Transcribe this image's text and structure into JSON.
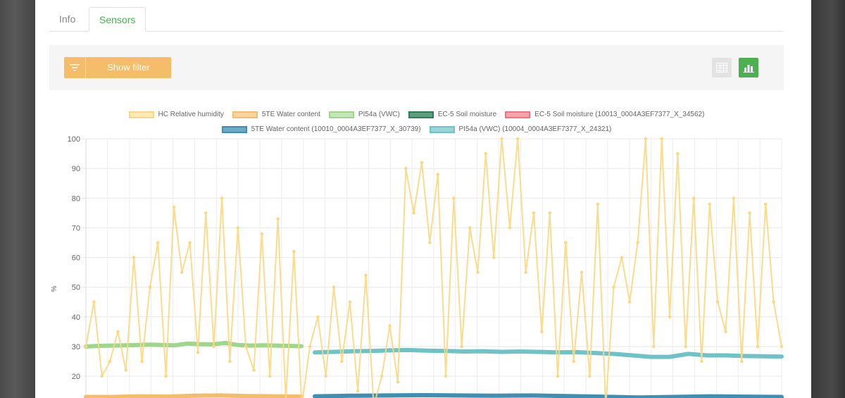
{
  "tabs": [
    {
      "label": "Info",
      "active": false
    },
    {
      "label": "Sensors",
      "active": true
    }
  ],
  "toolbar": {
    "filter_label": "Show filter",
    "filter_icon": "filter-icon",
    "table_view_icon": "table-icon",
    "chart_view_icon": "bar-chart-icon",
    "accent_color": "#f5bc6a",
    "active_view_color": "#4caf50"
  },
  "chart_data": {
    "type": "line",
    "ylabel": "%",
    "ylim": [
      20,
      100
    ],
    "yticks": [
      100,
      90,
      80,
      70,
      60,
      50,
      40,
      30,
      20
    ],
    "grid": true,
    "legend_position": "top-center",
    "legend": [
      {
        "name": "HC Relative humidity",
        "color": "#fbd880"
      },
      {
        "name": "5TE Water content",
        "color": "#f5bc6a"
      },
      {
        "name": "PI54a (VWC)",
        "color": "#9ed68c"
      },
      {
        "name": "EC-5 Soil moisture",
        "color": "#2e7d59"
      },
      {
        "name": "EC-5 Soil moisture (10013_0004A3EF7377_X_34562)",
        "color": "#f4727e"
      },
      {
        "name": "5TE Water content (10010_0004A3EF7377_X_30739)",
        "color": "#3e8fb3"
      },
      {
        "name": "PI54a (VWC) (10004_0004A3EF7377_X_24321)",
        "color": "#6fc2c6"
      }
    ],
    "series": [
      {
        "name": "HC Relative humidity",
        "color": "#fbd880",
        "values": [
          30,
          45,
          20,
          25,
          35,
          22,
          60,
          25,
          50,
          65,
          20,
          77,
          55,
          65,
          28,
          75,
          30,
          80,
          25,
          70,
          30,
          22,
          68,
          20,
          73,
          12,
          62,
          10,
          30,
          40,
          20,
          50,
          25,
          45,
          15,
          54,
          10,
          20,
          37,
          18,
          90,
          75,
          92,
          65,
          88,
          20,
          80,
          30,
          70,
          55,
          95,
          60,
          100,
          70,
          100,
          55,
          75,
          35,
          75,
          20,
          65,
          25,
          55,
          20,
          78,
          10,
          50,
          60,
          45,
          65,
          100,
          30,
          100,
          40,
          95,
          30,
          80,
          25,
          78,
          45,
          35,
          80,
          25,
          75,
          30,
          78,
          45,
          30
        ]
      },
      {
        "name": "PI54a (VWC)",
        "color": "#9ed68c",
        "values": [
          30,
          30.2,
          30.3,
          30.4,
          30.5,
          30.6,
          30.5,
          30.4,
          31,
          30.8,
          30.7,
          31.2,
          30.5,
          30.3,
          30.4,
          30.3,
          30.2,
          30.1
        ]
      },
      {
        "name": "PI54a (VWC) (10004_0004A3EF7377_X_24321)",
        "color": "#6fc2c6",
        "values": [
          28,
          28.2,
          28.4,
          28.5,
          28.7,
          28.8,
          28.6,
          28.5,
          28.3,
          28.4,
          28.2,
          28.3,
          28.2,
          28,
          28.1,
          27.8,
          27.5,
          27,
          26.5,
          26.5,
          27.5,
          27,
          27,
          26.8,
          26.7,
          26.6
        ]
      },
      {
        "name": "5TE Water content",
        "color": "#f5bc6a",
        "values": [
          13,
          13,
          13.2,
          13.1,
          13.4,
          13.5,
          13.3,
          13.2,
          13.1
        ]
      },
      {
        "name": "5TE Water content (10010_0004A3EF7377_X_30739)",
        "color": "#3e8fb3",
        "values": [
          13.2,
          13.4,
          13.5,
          13.6,
          13.5,
          13.4,
          13.5,
          13.3,
          13.1,
          12.8,
          13,
          13.2,
          13.1,
          13
        ]
      }
    ]
  }
}
